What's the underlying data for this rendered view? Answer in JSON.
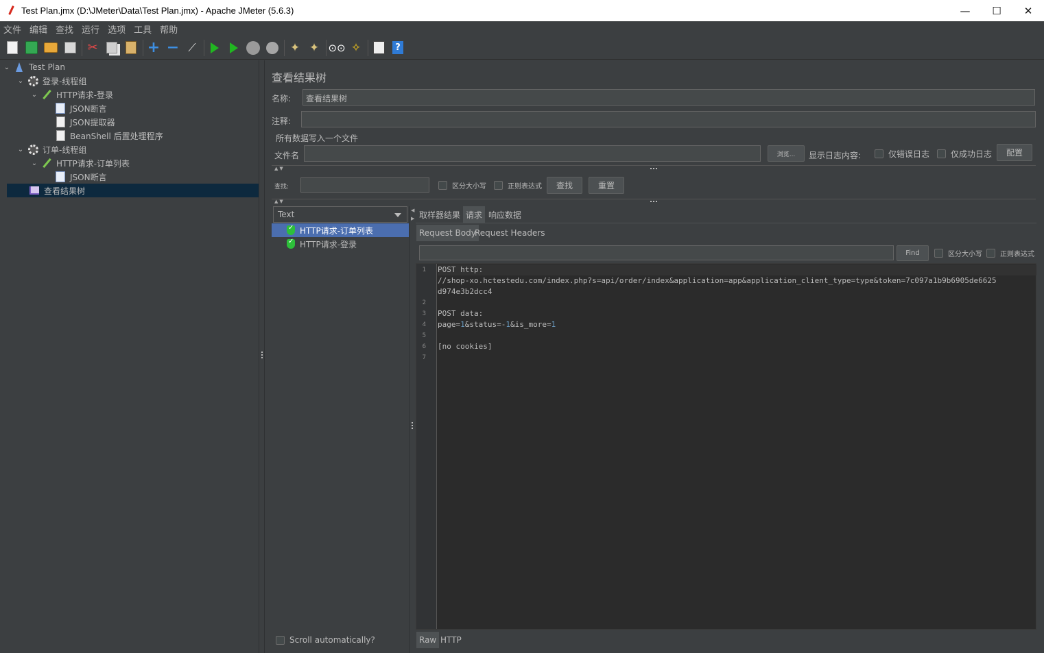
{
  "window": {
    "title": "Test Plan.jmx (D:\\JMeter\\Data\\Test Plan.jmx) - Apache JMeter (5.6.3)",
    "minimize": "—",
    "maximize": "☐",
    "close": "✕"
  },
  "menu": [
    "文件",
    "编辑",
    "查找",
    "运行",
    "选项",
    "工具",
    "帮助"
  ],
  "tree": [
    {
      "label": "Test Plan",
      "icon": "flask-icon",
      "level": 0,
      "expanded": true
    },
    {
      "label": "登录-线程组",
      "icon": "gear-icon",
      "level": 1,
      "expanded": true
    },
    {
      "label": "HTTP请求-登录",
      "icon": "pipette-icon",
      "level": 2,
      "expanded": true
    },
    {
      "label": "JSON断言",
      "icon": "assertion-icon",
      "level": 3
    },
    {
      "label": "JSON提取器",
      "icon": "extractor-icon",
      "level": 3
    },
    {
      "label": "BeanShell 后置处理程序",
      "icon": "script-icon",
      "level": 3
    },
    {
      "label": "订单-线程组",
      "icon": "gear-icon",
      "level": 1,
      "expanded": true
    },
    {
      "label": "HTTP请求-订单列表",
      "icon": "pipette-icon",
      "level": 2,
      "expanded": true
    },
    {
      "label": "JSON断言",
      "icon": "assertion-icon",
      "level": 3
    },
    {
      "label": "查看结果树",
      "icon": "graph-icon",
      "level": 2,
      "selected": true
    }
  ],
  "panel": {
    "title": "查看结果树",
    "name_label": "名称:",
    "name_value": "查看结果树",
    "comment_label": "注释:",
    "comment_value": "",
    "file_section": "所有数据写入一个文件",
    "filename_label": "文件名",
    "filename_value": "",
    "browse": "浏览...",
    "log_label": "显示日志内容:",
    "errors_only": "仅错误日志",
    "success_only": "仅成功日志",
    "configure": "配置",
    "search_label": "查找:",
    "search_value": "",
    "case_sensitive": "区分大小写",
    "regex": "正则表达式",
    "find_btn": "查找",
    "reset_btn": "重置"
  },
  "results": {
    "renderer": "Text",
    "items": [
      {
        "label": "HTTP请求-订单列表",
        "selected": true
      },
      {
        "label": "HTTP请求-登录",
        "selected": false
      }
    ],
    "scroll_auto": "Scroll automatically?"
  },
  "tabs": [
    "取样器结果",
    "请求",
    "响应数据"
  ],
  "active_tab": "请求",
  "subtabs": [
    "Request Body",
    "Request Headers"
  ],
  "active_subtab": "Request Body",
  "editor_search": {
    "value": "",
    "find": "Find",
    "case_sensitive": "区分大小写",
    "regex": "正则表达式"
  },
  "editor": {
    "line_numbers": [
      "1",
      "2",
      "3",
      "4",
      "5",
      "6",
      "7"
    ],
    "line1": "POST http:",
    "line1_cont1": "//shop-xo.hctestedu.com/index.php?s=api/order/index&application=app&application_client_type=type&token=7c097a1b9b6905de6625",
    "line1_cont2": "d974e3b2dcc4",
    "line3": "POST data:",
    "line4_a": "page=",
    "line4_b": "1",
    "line4_c": "&status=-",
    "line4_d": "1",
    "line4_e": "&is_more=",
    "line4_f": "1",
    "line6": "[no cookies]"
  },
  "bottom_tabs": [
    "Raw",
    "HTTP"
  ],
  "active_bottom_tab": "Raw"
}
